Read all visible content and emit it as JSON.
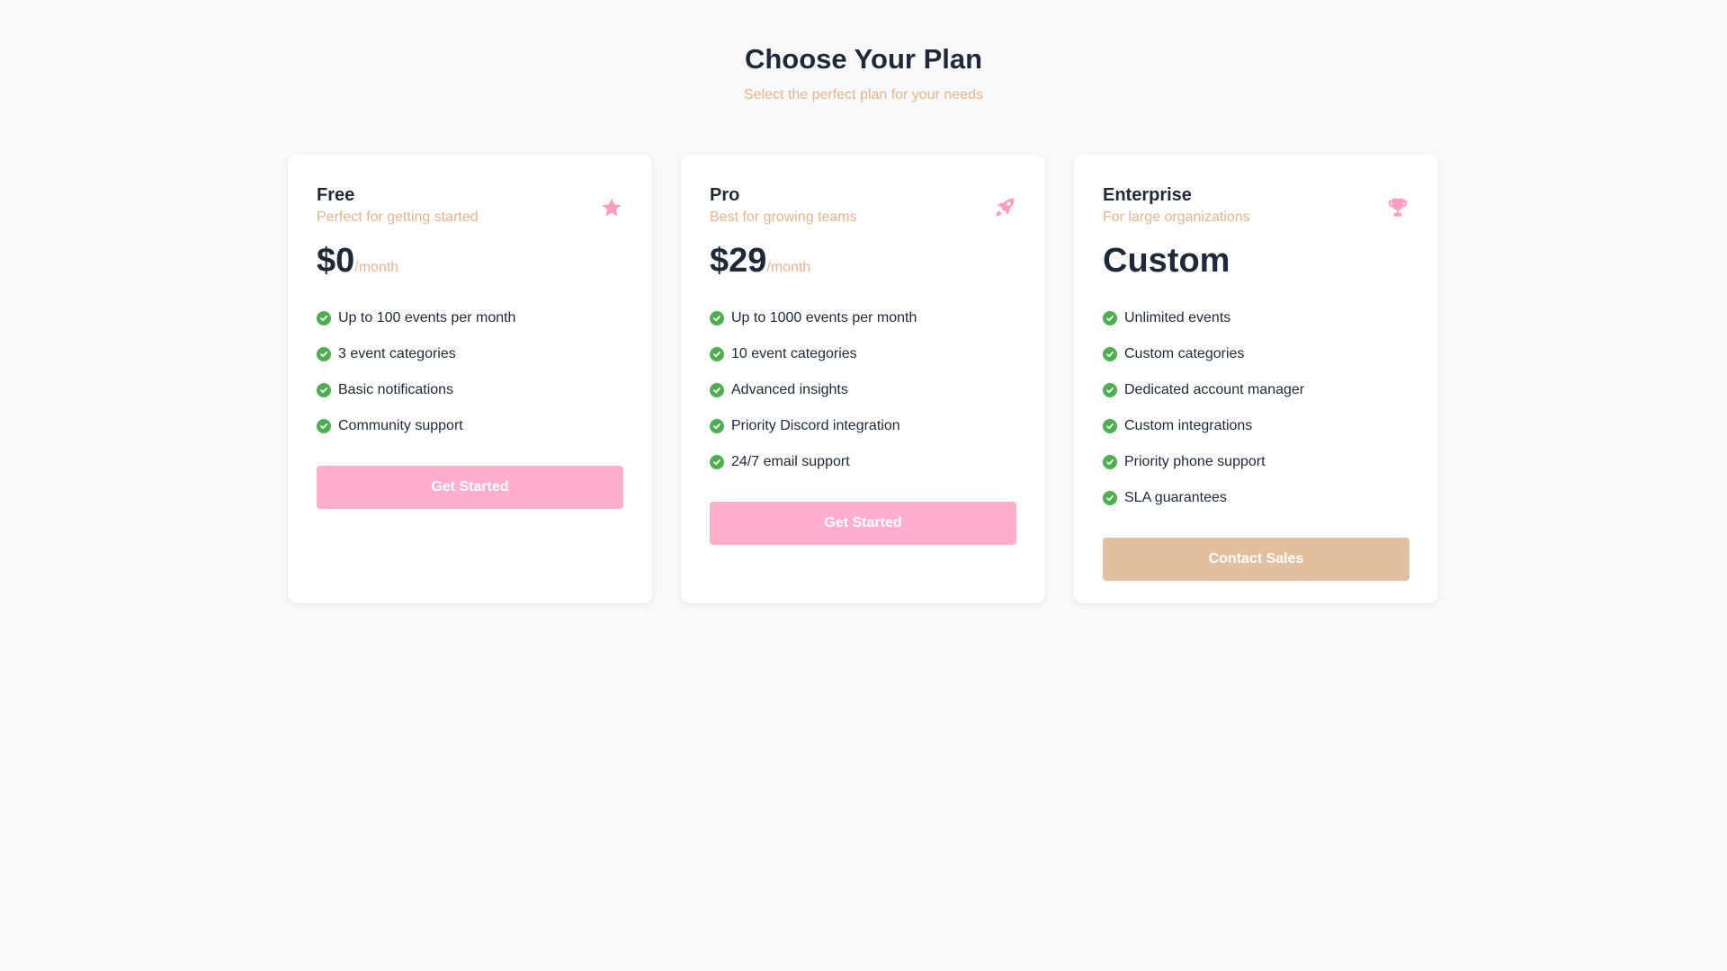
{
  "header": {
    "title": "Choose Your Plan",
    "subtitle": "Select the perfect plan for your needs"
  },
  "colors": {
    "accent_pink": "#ffafcc",
    "accent_tan": "#e2c09f",
    "muted_text": "#e6b48e",
    "check_green": "#4caf50",
    "icon_pink": "#ff9ec2"
  },
  "plans": [
    {
      "name": "Free",
      "description": "Perfect for getting started",
      "icon": "star-icon",
      "price": "$0",
      "period": "/month",
      "features": [
        "Up to 100 events per month",
        "3 event categories",
        "Basic notifications",
        "Community support"
      ],
      "cta_label": "Get Started"
    },
    {
      "name": "Pro",
      "description": "Best for growing teams",
      "icon": "rocket-icon",
      "price": "$29",
      "period": "/month",
      "features": [
        "Up to 1000 events per month",
        "10 event categories",
        "Advanced insights",
        "Priority Discord integration",
        "24/7 email support"
      ],
      "cta_label": "Get Started"
    },
    {
      "name": "Enterprise",
      "description": "For large organizations",
      "icon": "trophy-icon",
      "price": "Custom",
      "period": "",
      "features": [
        "Unlimited events",
        "Custom categories",
        "Dedicated account manager",
        "Custom integrations",
        "Priority phone support",
        "SLA guarantees"
      ],
      "cta_label": "Contact Sales"
    }
  ]
}
